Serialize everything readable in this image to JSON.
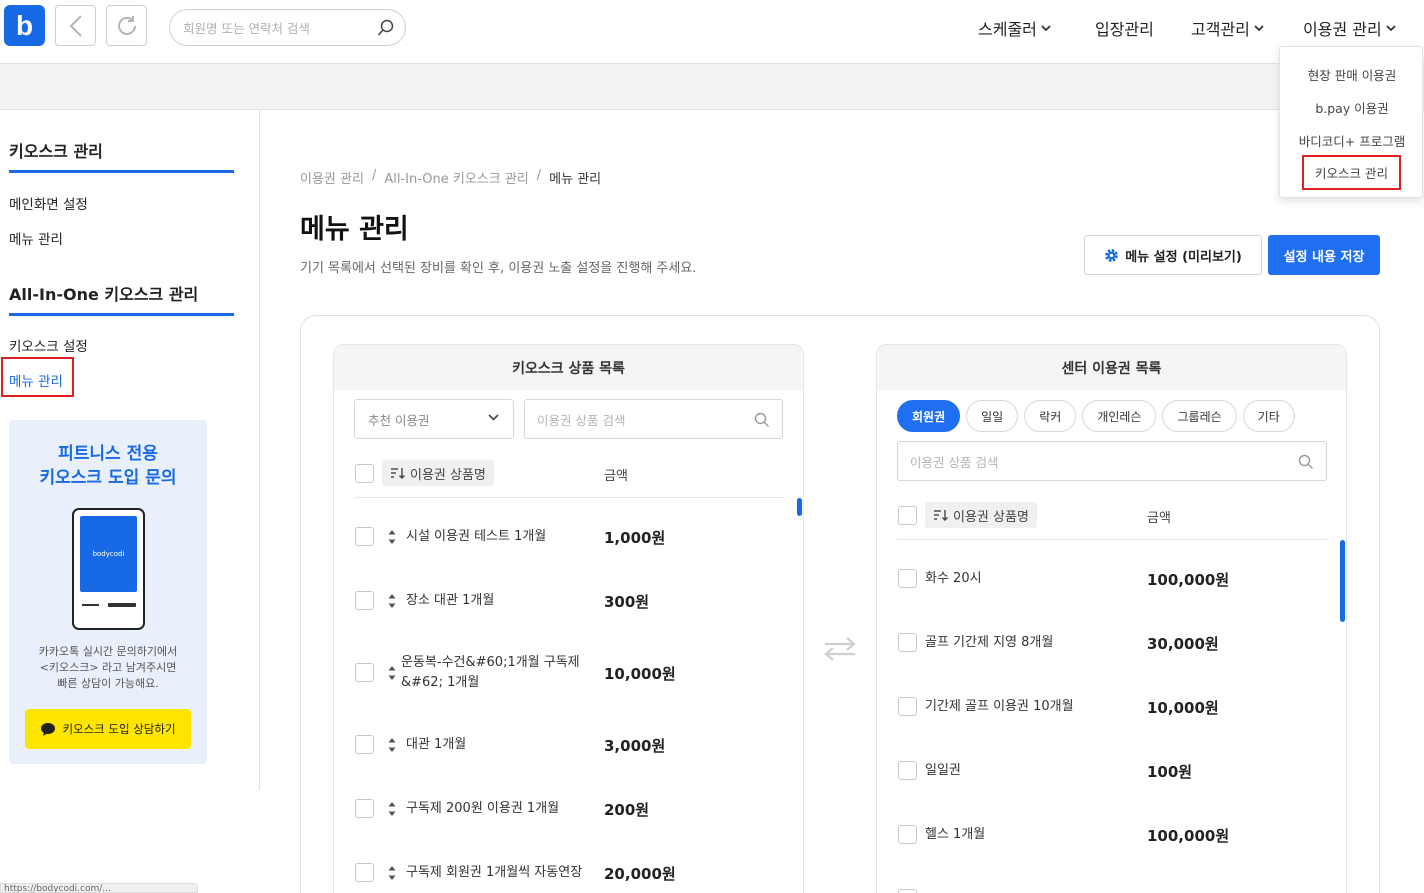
{
  "header": {
    "logo": "b",
    "search_placeholder": "회원명 또는 연락처 검색",
    "menu": [
      {
        "label": "스케줄러"
      },
      {
        "label": "입장관리"
      },
      {
        "label": "고객관리"
      },
      {
        "label": "이용권 관리"
      }
    ],
    "dropdown": [
      {
        "label": "현장 판매 이용권"
      },
      {
        "label": "b.pay 이용권"
      },
      {
        "label": "바디코디+ 프로그램"
      },
      {
        "label": "키오스크 관리"
      }
    ]
  },
  "sidebar": {
    "section1_title": "키오스크 관리",
    "section1_links": [
      {
        "label": "메인화면 설정"
      },
      {
        "label": "메뉴 관리"
      }
    ],
    "section2_title": "All-In-One 키오스크 관리",
    "section2_links": [
      {
        "label": "키오스크 설정"
      },
      {
        "label": "메뉴 관리"
      }
    ],
    "promo": {
      "title_line1": "피트니스 전용",
      "title_line2": "키오스크 도입 문의",
      "screen_text": "bodycodi",
      "desc_line1": "카카오톡 실시간 문의하기에서",
      "desc_line2": "<키오스크> 라고 남겨주시면",
      "desc_line3": "빠른 상담이 가능해요.",
      "button": "키오스크 도입 상담하기"
    }
  },
  "main": {
    "breadcrumb": [
      "이용권 관리",
      "/",
      "All-In-One 키오스크 관리",
      "/",
      "메뉴 관리"
    ],
    "title": "메뉴 관리",
    "description": "기기 목록에서 선택된 장비를 확인 후, 이용권 노출 설정을 진행해 주세요.",
    "preview_button": "메뉴 설정 (미리보기)",
    "save_button": "설정 내용 저장"
  },
  "kiosk_list": {
    "title": "키오스크 상품 목록",
    "select_value": "추천 이용권",
    "search_placeholder": "이용권 상품 검색",
    "col_name": "이용권 상품명",
    "col_price": "금액",
    "rows": [
      {
        "name": "시설 이용권 테스트 1개월",
        "price": "1,000원"
      },
      {
        "name": "장소 대관 1개월",
        "price": "300원"
      },
      {
        "name": "운동복-수건&#60;1개월 구독제",
        "name2": "&#62; 1개월",
        "price": "10,000원"
      },
      {
        "name": "대관 1개월",
        "price": "3,000원"
      },
      {
        "name": "구독제 200원 이용권 1개월",
        "price": "200원"
      },
      {
        "name": "구독제 회원권 1개월씩 자동연장",
        "price": "20,000원"
      }
    ]
  },
  "center_list": {
    "title": "센터 이용권 목록",
    "chips": [
      {
        "label": "회원권",
        "active": true
      },
      {
        "label": "일일"
      },
      {
        "label": "락커"
      },
      {
        "label": "개인레슨"
      },
      {
        "label": "그룹레슨"
      },
      {
        "label": "기타"
      }
    ],
    "search_placeholder": "이용권 상품 검색",
    "col_name": "이용권 상품명",
    "col_price": "금액",
    "rows": [
      {
        "name": "화수 20시",
        "price": "100,000원"
      },
      {
        "name": "골프 기간제 지영 8개월",
        "price": "30,000원"
      },
      {
        "name": "기간제 골프 이용권 10개월",
        "price": "10,000원"
      },
      {
        "name": "일일권",
        "price": "100원"
      },
      {
        "name": "헬스 1개월",
        "price": "100,000원"
      }
    ]
  },
  "colors": {
    "accent": "#1769e6",
    "highlight_border": "#e02020",
    "kakao": "#fee500"
  },
  "icons": [
    "search-icon",
    "back-arrow-icon",
    "refresh-icon",
    "chevron-down-icon",
    "gear-icon",
    "sort-icon",
    "swap-arrows-icon",
    "chat-bubble-icon"
  ],
  "statusbar": "https://bodycodi.com/..."
}
